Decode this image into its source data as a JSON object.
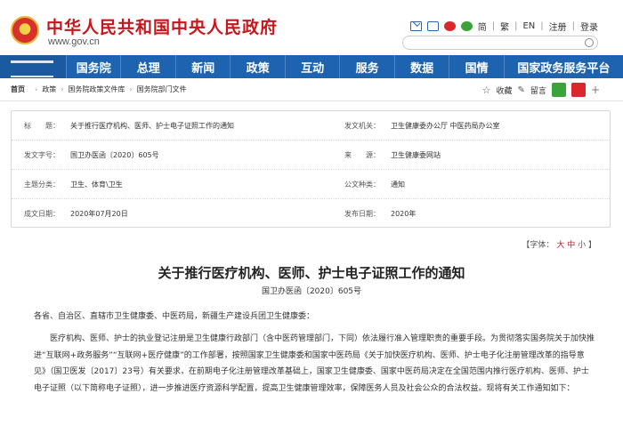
{
  "header": {
    "site_title": "中华人民共和国中央人民政府",
    "site_domain": "www.gov.cn",
    "top_links": [
      "简",
      "繁",
      "EN",
      "注册",
      "登录"
    ]
  },
  "nav": {
    "items": [
      "国务院",
      "总理",
      "新闻",
      "政策",
      "互动",
      "服务",
      "数据",
      "国情",
      "国家政务服务平台"
    ]
  },
  "breadcrumb": {
    "home": "首页",
    "items": [
      "政策",
      "国务院政策文件库",
      "国务院部门文件"
    ],
    "favorite": "收藏",
    "message": "留言"
  },
  "info": {
    "title_k": "标　　题：",
    "title_v": "关于推行医疗机构、医师、护士电子证照工作的通知",
    "issuer_k": "发文机关：",
    "issuer_v": "卫生健康委办公厅 中医药局办公室",
    "docno_k": "发文字号：",
    "docno_v": "国卫办医函〔2020〕605号",
    "source_k": "来　　源：",
    "source_v": "卫生健康委网站",
    "topic_k": "主题分类：",
    "topic_v": "卫生、体育\\卫生",
    "type_k": "公文种类：",
    "type_v": "通知",
    "written_k": "成文日期：",
    "written_v": "2020年07月20日",
    "published_k": "发布日期：",
    "published_v": "2020年"
  },
  "fontbar": {
    "label": "【字体：",
    "large": "大",
    "medium": "中",
    "small": "小",
    "close": "】"
  },
  "article": {
    "title": "关于推行医疗机构、医师、护士电子证照工作的通知",
    "doc_no": "国卫办医函〔2020〕605号",
    "recipients": "各省、自治区、直辖市卫生健康委、中医药局，新疆生产建设兵团卫生健康委：",
    "body": "医疗机构、医师、护士的执业登记注册是卫生健康行政部门（含中医药管理部门，下同）依法履行准入管理职责的重要手段。为贯彻落实国务院关于加快推进“互联网+政务服务”“互联网+医疗健康”的工作部署，按照国家卫生健康委和国家中医药局《关于加快医疗机构、医师、护士电子化注册管理改革的指导意见》（国卫医发〔2017〕23号）有关要求，在前期电子化注册管理改革基础上，国家卫生健康委、国家中医药局决定在全国范围内推行医疗机构、医师、护士电子证照（以下简称电子证照），进一步推进医疗资源科学配置，提高卫生健康管理效率，保障医务人员及社会公众的合法权益。现将有关工作通知如下："
  }
}
